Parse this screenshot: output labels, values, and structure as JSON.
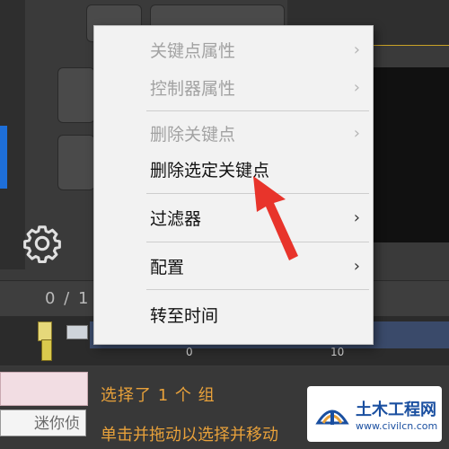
{
  "context_menu": {
    "items": [
      {
        "label": "关键点属性",
        "enabled": false,
        "submenu": true
      },
      {
        "label": "控制器属性",
        "enabled": false,
        "submenu": true
      },
      {
        "label": "删除关键点",
        "enabled": false,
        "submenu": true
      },
      {
        "label": "删除选定关键点",
        "enabled": true,
        "submenu": false
      },
      {
        "label": "过滤器",
        "enabled": true,
        "submenu": true
      },
      {
        "label": "配置",
        "enabled": true,
        "submenu": true
      },
      {
        "label": "转至时间",
        "enabled": true,
        "submenu": false
      }
    ],
    "chevron": "›"
  },
  "timeline": {
    "frame_counter": "0 / 1",
    "ticks": [
      "0",
      "10"
    ]
  },
  "bottom": {
    "mini_listener": "迷你侦",
    "status_line1": "选择了 1 个 组",
    "status_line2": "单击并拖动以选择并移动"
  },
  "watermark": {
    "title": "土木工程网",
    "url": "www.civilcn.com"
  },
  "colors": {
    "accent_arrow": "#e8342b",
    "status_text": "#e8a13a",
    "watermark_blue": "#1a4fa0"
  },
  "icons": {
    "settings": "gear-icon",
    "annotation": "red-arrow-icon",
    "watermark": "watermark-logo-icon"
  }
}
